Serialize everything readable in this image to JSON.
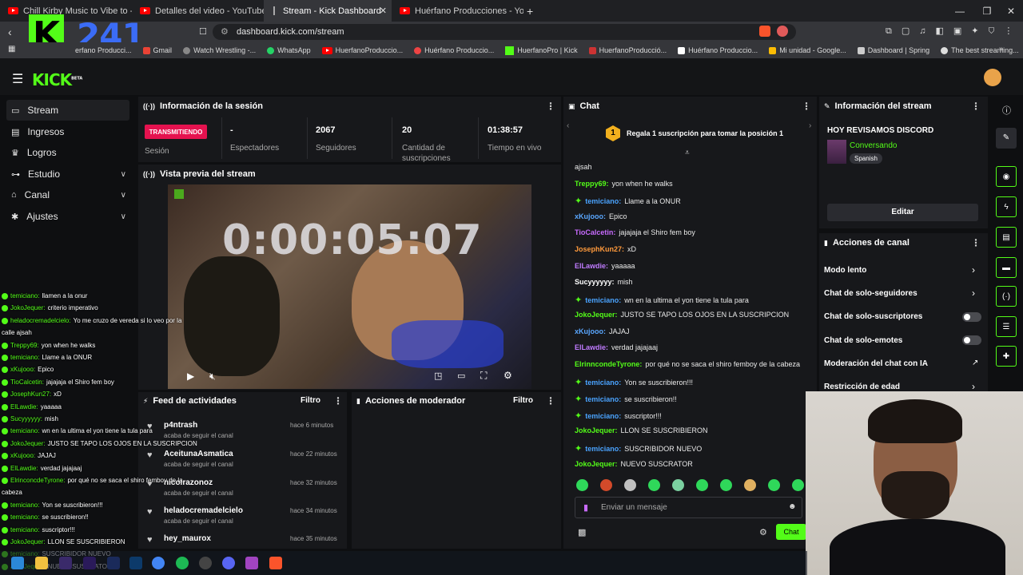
{
  "browser": {
    "tabs": [
      {
        "label": "Chill Kirby Music to Vibe to - YouTub",
        "icon": "youtube-icon"
      },
      {
        "label": "Detalles del video - YouTube Studio",
        "icon": "youtube-icon"
      },
      {
        "label": "Stream - Kick Dashboard",
        "icon": "kick-icon",
        "active": true
      },
      {
        "label": "Huérfano Producciones - YouTube",
        "icon": "youtube-icon"
      }
    ],
    "url": "dashboard.kick.com/stream",
    "bookmarks": [
      "Gmail",
      "Watch Wrestling -...",
      "WhatsApp",
      "HuerfanoProduccio...",
      "Huérfano Produccio...",
      "HuerfanoPro | Kick",
      "HuerfanoProducció...",
      "Huérfano Produccio...",
      "Mi unidad - Google...",
      "Dashboard | Spring",
      "The best streaming..."
    ],
    "bookmark_partial": "erfano Producci..."
  },
  "overlay": {
    "counter": "241",
    "logo_letter": "K"
  },
  "kick": {
    "logo": "KICK",
    "logo_sup": "BETA"
  },
  "sidebar": {
    "items": [
      {
        "label": "Stream",
        "icon": "broadcast-icon",
        "active": true
      },
      {
        "label": "Ingresos",
        "icon": "revenue-icon"
      },
      {
        "label": "Logros",
        "icon": "trophy-icon"
      },
      {
        "label": "Estudio",
        "icon": "studio-icon",
        "expand": true
      },
      {
        "label": "Canal",
        "icon": "channel-icon",
        "expand": true
      },
      {
        "label": "Ajustes",
        "icon": "settings-icon",
        "expand": true
      }
    ]
  },
  "session": {
    "title": "Información de la sesión",
    "status_badge": "TRANSMITIENDO",
    "stats": [
      {
        "value": "",
        "label": "Sesión"
      },
      {
        "value": "-",
        "label": "Espectadores"
      },
      {
        "value": "2067",
        "label": "Seguidores"
      },
      {
        "value": "20",
        "label": "Cantidad de suscripciones"
      },
      {
        "value": "01:38:57",
        "label": "Tiempo en vivo"
      }
    ]
  },
  "preview": {
    "title": "Vista previa del stream",
    "timer": "0:00:05:07"
  },
  "feed": {
    "title": "Feed de actividades",
    "filter": "Filtro",
    "items": [
      {
        "name": "p4ntrash",
        "action": "acaba de seguir el canal",
        "time": "hace 6 minutos"
      },
      {
        "name": "AceitunaAsmatica",
        "action": "acaba de seguir el canal",
        "time": "hace 22 minutos"
      },
      {
        "name": "nicoirazonoz",
        "action": "acaba de seguir el canal",
        "time": "hace 32 minutos"
      },
      {
        "name": "heladocremadelcielo",
        "action": "acaba de seguir el canal",
        "time": "hace 34 minutos"
      },
      {
        "name": "hey_maurox",
        "action": "",
        "time": "hace 35 minutos"
      }
    ]
  },
  "moderator": {
    "title": "Acciones de moderador",
    "filter": "Filtro"
  },
  "chat": {
    "title": "Chat",
    "pinned": "Regala 1 suscripción para tomar la posición 1",
    "pinned_rank": "1",
    "messages": [
      {
        "user": "",
        "text": "ajsah",
        "color": "#ffffff",
        "badge": false
      },
      {
        "user": "Treppy69:",
        "text": "yon when he walks",
        "color": "#53fc18",
        "badge": false
      },
      {
        "user": "temiciano:",
        "text": "Llame a la ONUR",
        "color": "#4aa3ff",
        "badge": true
      },
      {
        "user": "xKujooo:",
        "text": "Epico",
        "color": "#5aa7ff",
        "badge": false
      },
      {
        "user": "TioCalcetin:",
        "text": "jajajaja el Shiro fem boy",
        "color": "#c86bff",
        "badge": false
      },
      {
        "user": "JosephKun27:",
        "text": "xD",
        "color": "#ff9a3c",
        "badge": false
      },
      {
        "user": "ElLawdie:",
        "text": "yaaaaa",
        "color": "#c07bff",
        "badge": false
      },
      {
        "user": "Sucyyyyyy:",
        "text": "mish",
        "color": "#ffffff",
        "badge": false
      },
      {
        "user": "temiciano:",
        "text": "wn en la ultima el yon tiene la tula para",
        "color": "#4aa3ff",
        "badge": true
      },
      {
        "user": "JokoJequer:",
        "text": "JUSTO SE TAPO LOS OJOS EN LA SUSCRIPCION",
        "color": "#53fc18",
        "badge": false
      },
      {
        "user": "xKujooo:",
        "text": "JAJAJ",
        "color": "#5aa7ff",
        "badge": false
      },
      {
        "user": "ElLawdie:",
        "text": "verdad jajajaaj",
        "color": "#c07bff",
        "badge": false
      },
      {
        "user": "ElrinncondeTyrone:",
        "text": "por qué no se saca el shiro femboy de la cabeza",
        "color": "#53fc18",
        "badge": false
      },
      {
        "user": "temiciano:",
        "text": "Yon se suscribieron!!!",
        "color": "#4aa3ff",
        "badge": true
      },
      {
        "user": "temiciano:",
        "text": "se suscribieron!!",
        "color": "#4aa3ff",
        "badge": true
      },
      {
        "user": "temiciano:",
        "text": "suscriptor!!!",
        "color": "#4aa3ff",
        "badge": true
      },
      {
        "user": "JokoJequer:",
        "text": "LLON SE SUSCRIBIERON",
        "color": "#53fc18",
        "badge": false
      },
      {
        "user": "temiciano:",
        "text": "SUSCRIBIDOR NUEVO",
        "color": "#4aa3ff",
        "badge": true
      },
      {
        "user": "JokoJequer:",
        "text": "NUEVO SUSCRATOR",
        "color": "#53fc18",
        "badge": false
      }
    ],
    "input_placeholder": "Enviar un mensaje",
    "send_label": "Chat"
  },
  "overlay_chat": [
    {
      "user": "temiciano:",
      "text": "llamen a la onur"
    },
    {
      "user": "JokoJequer:",
      "text": "criterio imperativo"
    },
    {
      "user": "heladocremadelcielo:",
      "text": "Yo me cruzo de vereda si lo veo por la"
    },
    {
      "user": "",
      "text": "calle ajsah"
    },
    {
      "user": "Treppy69:",
      "text": "yon when he walks"
    },
    {
      "user": "temiciano:",
      "text": "Llame a la ONUR"
    },
    {
      "user": "xKujooo:",
      "text": "Epico"
    },
    {
      "user": "TioCalcetin:",
      "text": "jajajaja el Shiro fem boy"
    },
    {
      "user": "JosephKun27:",
      "text": "xD"
    },
    {
      "user": "ElLawdie:",
      "text": "yaaaaa"
    },
    {
      "user": "Sucyyyyyy:",
      "text": "mish"
    },
    {
      "user": "temiciano:",
      "text": "wn en la ultima el yon tiene la tula para"
    },
    {
      "user": "JokoJequer:",
      "text": "JUSTO SE TAPO LOS OJOS EN LA SUSCRIPCION"
    },
    {
      "user": "xKujooo:",
      "text": "JAJAJ"
    },
    {
      "user": "ElLawdie:",
      "text": "verdad jajajaaj"
    },
    {
      "user": "ElrinconcdeTyrone:",
      "text": "por qué no se saca el shiro femboy de la"
    },
    {
      "user": "",
      "text": "cabeza"
    },
    {
      "user": "temiciano:",
      "text": "Yon se suscribieron!!!"
    },
    {
      "user": "temiciano:",
      "text": "se suscribieron!!"
    },
    {
      "user": "temiciano:",
      "text": "suscriptor!!!"
    },
    {
      "user": "JokoJequer:",
      "text": "LLON SE SUSCRIBIERON"
    },
    {
      "user": "temiciano:",
      "text": "SUSCRIBIDOR NUEVO"
    },
    {
      "user": "JokoJequer:",
      "text": "NUEVO SUSCRATOR"
    }
  ],
  "stream_info": {
    "title": "Información del stream",
    "stream_title": "HOY REVISAMOS DISCORD",
    "category": "Conversando",
    "language": "Spanish",
    "edit_label": "Editar"
  },
  "channel_actions": {
    "title": "Acciones de canal",
    "items": [
      {
        "label": "Modo lento",
        "control": "arrow"
      },
      {
        "label": "Chat de solo-seguidores",
        "control": "arrow"
      },
      {
        "label": "Chat de solo-suscriptores",
        "control": "toggle"
      },
      {
        "label": "Chat de solo-emotes",
        "control": "toggle"
      },
      {
        "label": "Moderación del chat con IA",
        "control": "link"
      },
      {
        "label": "Restricción de edad",
        "control": "arrow"
      }
    ]
  },
  "colors": {
    "kick_green": "#53fc18",
    "live_red": "#e5124f"
  }
}
